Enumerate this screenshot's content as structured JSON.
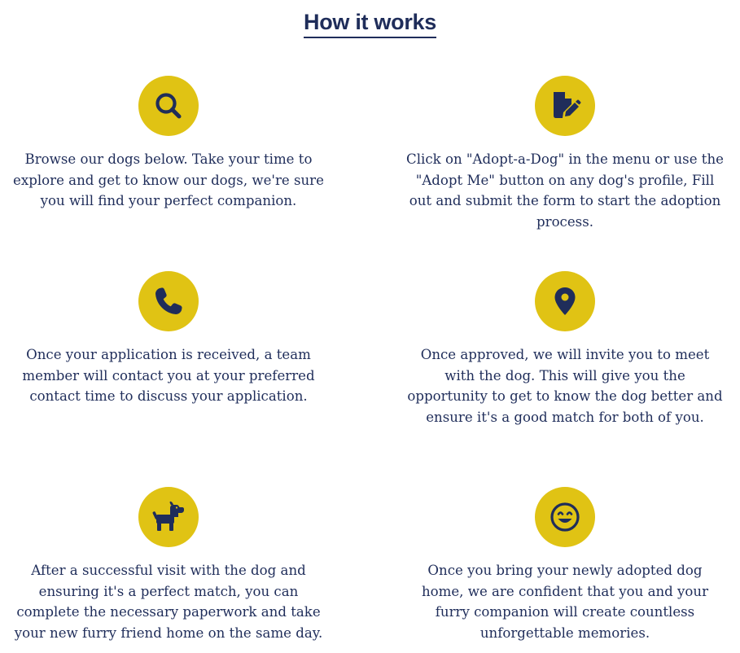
{
  "section": {
    "title": "How it works"
  },
  "colors": {
    "accent": "#e0c314",
    "navy": "#1f2d5a"
  },
  "steps": [
    {
      "icon": "search-icon",
      "text": "Browse our dogs below. Take your time to explore and get to know our dogs, we're sure you will find your perfect companion."
    },
    {
      "icon": "file-edit-icon",
      "text": "Click on \"Adopt-a-Dog\" in the menu or use the \"Adopt Me\" button on any dog's profile, Fill out and submit the form to start the adoption process."
    },
    {
      "icon": "phone-icon",
      "text": "Once your application is received, a team member will contact you at your preferred contact time to discuss your application."
    },
    {
      "icon": "map-pin-icon",
      "text": "Once approved, we will invite you to meet with the dog. This will give you the opportunity to get to know the dog better and ensure it's a good match for both of you."
    },
    {
      "icon": "dog-icon",
      "text": "After a successful visit with the dog and ensuring it's a perfect match, you can complete the necessary paperwork and take your new furry friend home on the same day."
    },
    {
      "icon": "smile-icon",
      "text": "Once you bring your newly adopted dog home, we are confident that you and your furry companion will create countless unforgettable memories."
    }
  ]
}
